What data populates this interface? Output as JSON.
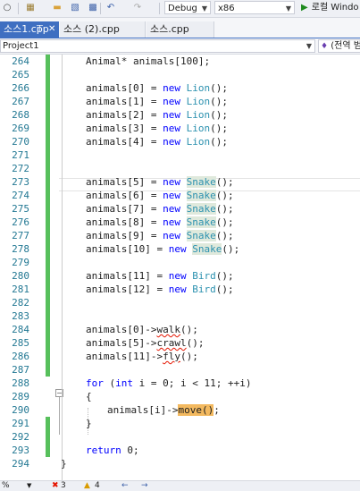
{
  "toolbar": {
    "config": "Debug",
    "platform": "x86",
    "run_label": "로컬 Windo"
  },
  "tabs": [
    {
      "label": "소스1.cpp",
      "active": true
    },
    {
      "label": "소스 (2).cpp",
      "active": false
    },
    {
      "label": "소스.cpp",
      "active": false
    }
  ],
  "navbar": {
    "project": "Project1",
    "scope": "(전역 범"
  },
  "editor": {
    "lines": [
      {
        "num": "264",
        "text": "Animal* animals[100];",
        "changed": true
      },
      {
        "num": "265",
        "text": "",
        "changed": true
      },
      {
        "num": "266",
        "text": "animals[0] = new Lion();",
        "changed": true
      },
      {
        "num": "267",
        "text": "animals[1] = new Lion();",
        "changed": true
      },
      {
        "num": "268",
        "text": "animals[2] = new Lion();",
        "changed": true
      },
      {
        "num": "269",
        "text": "animals[3] = new Lion();",
        "changed": true
      },
      {
        "num": "270",
        "text": "animals[4] = new Lion();",
        "changed": true
      },
      {
        "num": "271",
        "text": "",
        "changed": true
      },
      {
        "num": "272",
        "text": "",
        "changed": true
      },
      {
        "num": "273",
        "text": "animals[5] = new Snake();",
        "changed": true
      },
      {
        "num": "274",
        "text": "animals[6] = new Snake();",
        "changed": true
      },
      {
        "num": "275",
        "text": "animals[7] = new Snake();",
        "changed": true
      },
      {
        "num": "276",
        "text": "animals[8] = new Snake();",
        "changed": true
      },
      {
        "num": "277",
        "text": "animals[9] = new Snake();",
        "changed": true
      },
      {
        "num": "278",
        "text": "animals[10] = new Snake();",
        "changed": true
      },
      {
        "num": "279",
        "text": "",
        "changed": true
      },
      {
        "num": "280",
        "text": "animals[11] = new Bird();",
        "changed": true
      },
      {
        "num": "281",
        "text": "animals[12] = new Bird();",
        "changed": true
      },
      {
        "num": "282",
        "text": "",
        "changed": true
      },
      {
        "num": "283",
        "text": "",
        "changed": true
      },
      {
        "num": "284",
        "text": "animals[0]->walk();",
        "changed": true
      },
      {
        "num": "285",
        "text": "animals[5]->crawl();",
        "changed": true
      },
      {
        "num": "286",
        "text": "animals[11]->fly();",
        "changed": true
      },
      {
        "num": "287",
        "text": "",
        "changed": true
      },
      {
        "num": "288",
        "text": "for (int i = 0; i < 11; ++i)",
        "changed": false
      },
      {
        "num": "289",
        "text": "{",
        "changed": false
      },
      {
        "num": "290",
        "text": "animals[i]->move();",
        "changed": false
      },
      {
        "num": "291",
        "text": "}",
        "changed": true
      },
      {
        "num": "292",
        "text": "",
        "changed": true
      },
      {
        "num": "293",
        "text": "return 0;",
        "changed": true
      },
      {
        "num": "294",
        "text": "}",
        "changed": false
      }
    ]
  },
  "statusbar": {
    "zoom": "%",
    "errors": "3",
    "warnings": "4"
  },
  "colors": {
    "accent": "#3f6fc1",
    "keyword": "#0000ff",
    "type": "#2b91af",
    "linenum": "#237893",
    "changed": "#57c05c",
    "highlight": "#f3b95f"
  }
}
